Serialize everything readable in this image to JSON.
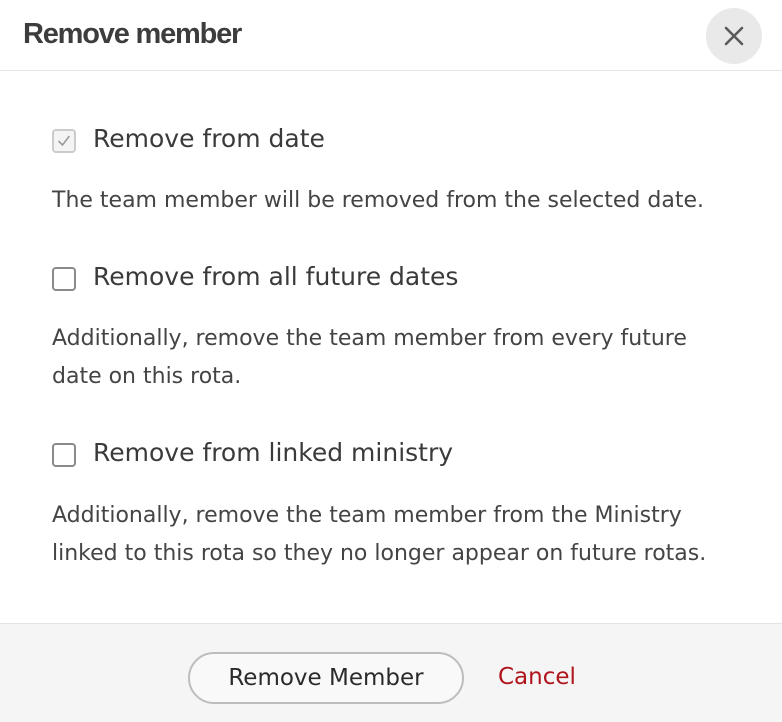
{
  "dialog": {
    "title": "Remove member",
    "close_icon": "close-icon"
  },
  "options": [
    {
      "label": "Remove from date",
      "checked": true,
      "disabled": true,
      "description": "The team member will be removed from the selected date."
    },
    {
      "label": "Remove from all future dates",
      "checked": false,
      "disabled": false,
      "description": "Additionally, remove the team member from every future date on this rota."
    },
    {
      "label": "Remove from linked ministry",
      "checked": false,
      "disabled": false,
      "description": "Additionally, remove the team member from the Ministry linked to this rota so they no longer appear on future rotas."
    }
  ],
  "footer": {
    "primary_label": "Remove Member",
    "cancel_label": "Cancel"
  },
  "colors": {
    "cancel": "#b0141c",
    "close_bg": "#e9e9e9",
    "footer_bg": "#f5f5f5"
  }
}
